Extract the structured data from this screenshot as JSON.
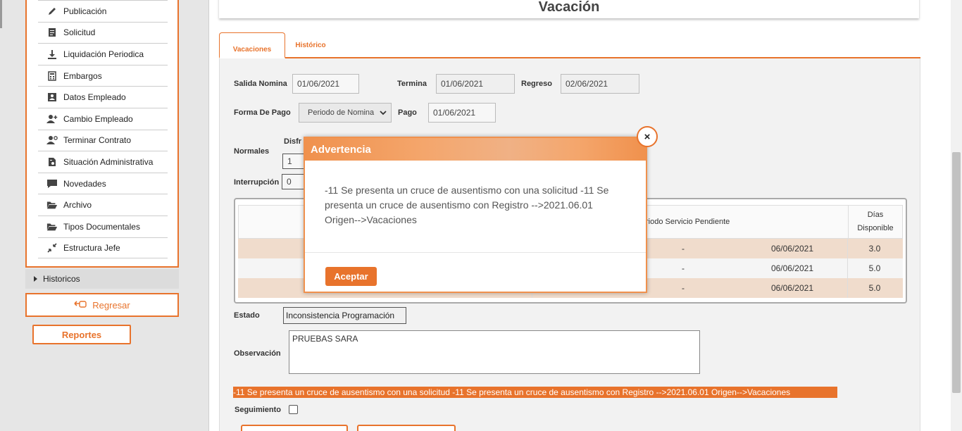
{
  "sidebar": {
    "items": [
      {
        "label": "Publicación",
        "icon": "pencil-icon"
      },
      {
        "label": "Solicitud",
        "icon": "document-icon"
      },
      {
        "label": "Liquidación Periodica",
        "icon": "download-icon"
      },
      {
        "label": "Embargos",
        "icon": "calculator-icon"
      },
      {
        "label": "Datos Empleado",
        "icon": "id-card-icon"
      },
      {
        "label": "Cambio Empleado",
        "icon": "user-plus-icon"
      },
      {
        "label": "Terminar Contrato",
        "icon": "user-settings-icon"
      },
      {
        "label": "Situación Administrativa",
        "icon": "file-settings-icon"
      },
      {
        "label": "Novedades",
        "icon": "comment-icon"
      },
      {
        "label": "Archivo",
        "icon": "folder-open-icon"
      },
      {
        "label": "Tipos Documentales",
        "icon": "folder-open-icon"
      },
      {
        "label": "Estructura Jefe",
        "icon": "compress-icon"
      }
    ],
    "historicos_label": "Historicos",
    "regresar_label": "Regresar",
    "reportes_label": "Reportes"
  },
  "page": {
    "title": "Vacación",
    "tabs": [
      {
        "label": "Vacaciones",
        "active": true
      },
      {
        "label": "Histórico",
        "active": false
      }
    ]
  },
  "form": {
    "salida_label": "Salida Nomina",
    "salida_value": "01/06/2021",
    "termina_label": "Termina",
    "termina_value": "01/06/2021",
    "regreso_label": "Regreso",
    "regreso_value": "02/06/2021",
    "forma_pago_label": "Forma De Pago",
    "forma_pago_value": "Periodo de Nomina",
    "pago_label": "Pago",
    "pago_value": "01/06/2021",
    "normales_label": "Normales",
    "disfrute_label": "Disfr",
    "disfrute_value": "1",
    "interrupcion_label": "Interrupción",
    "interrupcion_value": "0",
    "estado_label": "Estado",
    "estado_value": "Inconsistencia Programación",
    "observacion_label": "Observación",
    "observacion_value": "PRUEBAS SARA",
    "error_message": "-11 Se presenta un cruce de ausentismo con una solicitud -11 Se presenta un cruce de ausentismo con Registro -->2021.06.01 Origen-->Vacaciones",
    "seguimiento_label": "Seguimiento"
  },
  "table": {
    "headers": {
      "periodo": "riodo Servicio Pendiente",
      "dias": "Días Disponible"
    },
    "rows": [
      {
        "dash": "-",
        "date": "06/06/2021",
        "dias": "3.0"
      },
      {
        "dash": "-",
        "date": "06/06/2021",
        "dias": "5.0"
      },
      {
        "dash": "-",
        "date": "06/06/2021",
        "dias": "5.0"
      }
    ]
  },
  "modal": {
    "title": "Advertencia",
    "message": "-11 Se presenta un cruce de ausentismo con una solicitud -11 Se presenta un cruce de ausentismo con Registro -->2021.06.01 Origen-->Vacaciones",
    "accept_label": "Aceptar",
    "close_glyph": "×"
  },
  "colors": {
    "accent": "#e8732c",
    "modal_header": "#f0914d"
  }
}
